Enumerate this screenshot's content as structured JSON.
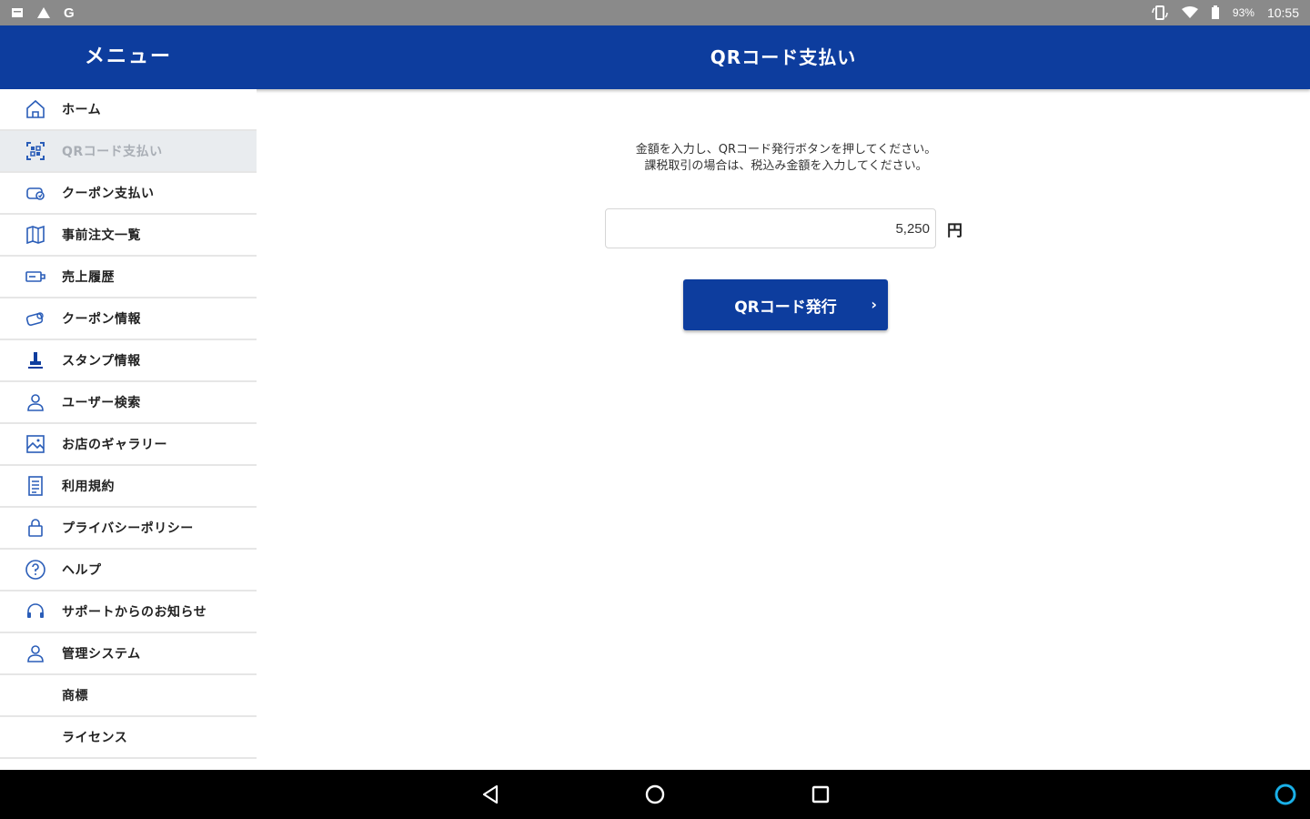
{
  "status_bar": {
    "left_icons": [
      "notification-icon",
      "warning-icon",
      "google-icon"
    ],
    "battery_percent": "93%",
    "time": "10:55"
  },
  "app_bar": {
    "menu_title": "メニュー",
    "page_title": "QRコード支払い"
  },
  "sidebar": {
    "items": [
      {
        "label": "ホーム",
        "icon": "home-icon",
        "active": false
      },
      {
        "label": "QRコード支払い",
        "icon": "qr-scan-icon",
        "active": true
      },
      {
        "label": "クーポン支払い",
        "icon": "coupon-icon",
        "active": false
      },
      {
        "label": "事前注文一覧",
        "icon": "map-icon",
        "active": false
      },
      {
        "label": "売上履歴",
        "icon": "sales-icon",
        "active": false
      },
      {
        "label": "クーポン情報",
        "icon": "coupon-info-icon",
        "active": false
      },
      {
        "label": "スタンプ情報",
        "icon": "stamp-icon",
        "active": false
      },
      {
        "label": "ユーザー検索",
        "icon": "user-search-icon",
        "active": false
      },
      {
        "label": "お店のギャラリー",
        "icon": "gallery-icon",
        "active": false
      },
      {
        "label": "利用規約",
        "icon": "document-icon",
        "active": false
      },
      {
        "label": "プライバシーポリシー",
        "icon": "lock-icon",
        "active": false
      },
      {
        "label": "ヘルプ",
        "icon": "help-icon",
        "active": false
      },
      {
        "label": "サポートからのお知らせ",
        "icon": "headset-icon",
        "active": false
      },
      {
        "label": "管理システム",
        "icon": "admin-user-icon",
        "active": false
      },
      {
        "label": "商標",
        "icon": "",
        "active": false
      },
      {
        "label": "ライセンス",
        "icon": "",
        "active": false
      }
    ]
  },
  "main": {
    "instruction_line1": "金額を入力し、QRコード発行ボタンを押してください。",
    "instruction_line2": "課税取引の場合は、税込み金額を入力してください。",
    "amount_value": "5,250",
    "currency": "円",
    "issue_button_label": "QRコード発行",
    "issue_button_chevron": "›"
  },
  "nav_bar": {
    "buttons": [
      "back-icon",
      "home-circle-icon",
      "recents-icon",
      "alexa-icon"
    ]
  },
  "colors": {
    "brand_blue": "#0d3d9e",
    "status_bar": "#8a8a8a",
    "active_item_bg": "#e9ecef",
    "alexa_cyan": "#1ab0e8"
  }
}
